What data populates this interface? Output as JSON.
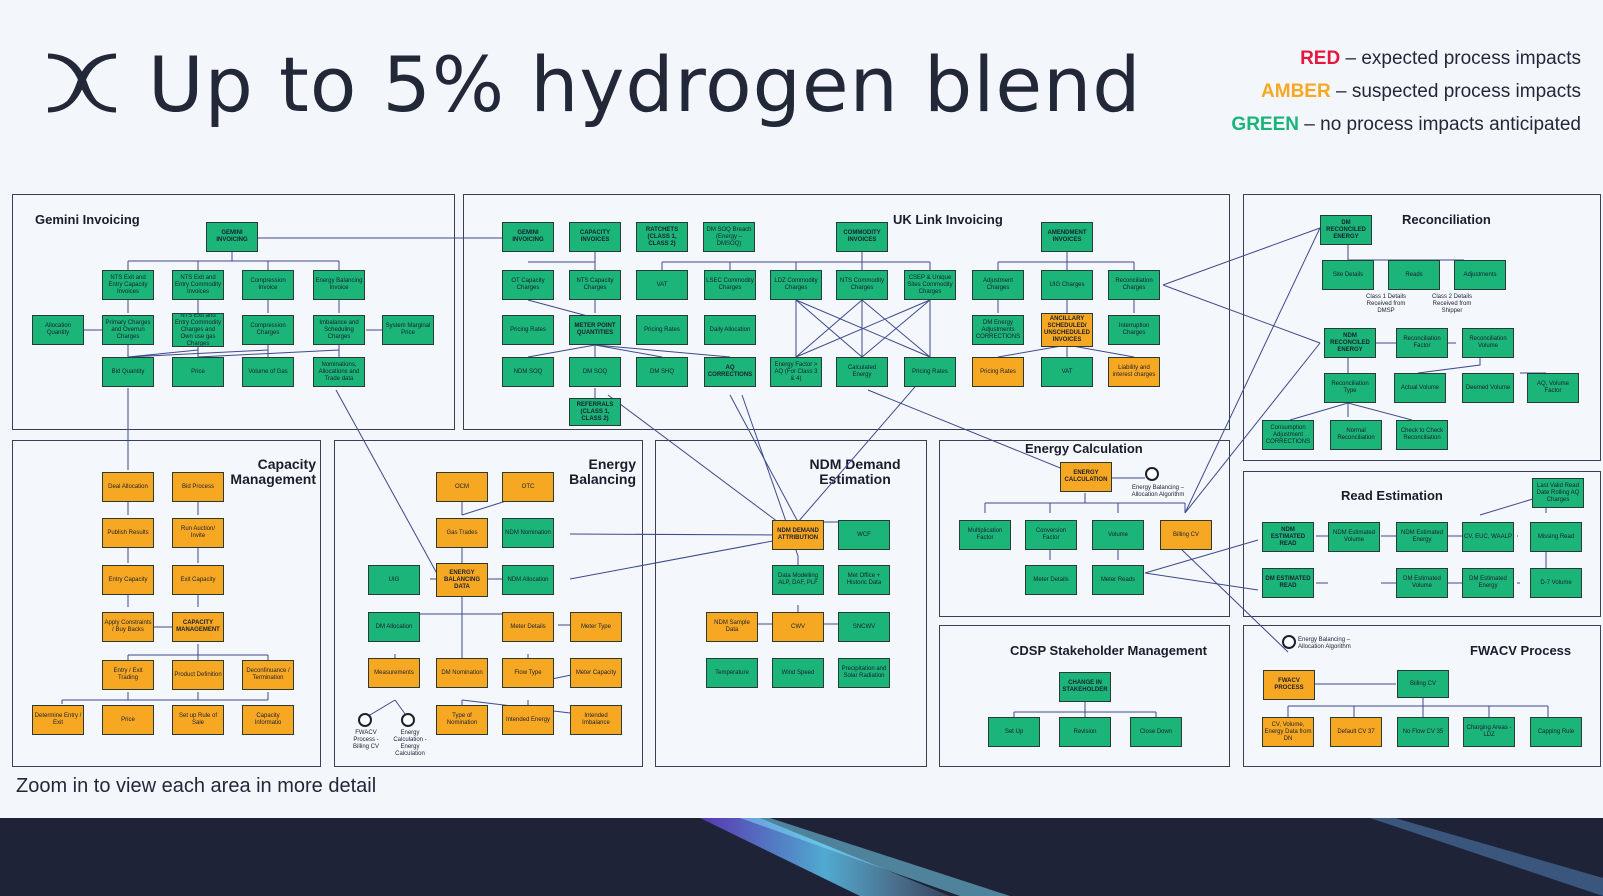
{
  "header": {
    "title": "Up to 5% hydrogen blend",
    "legend": [
      {
        "key": "RED",
        "text": " – expected process impacts",
        "color": "#e5173f"
      },
      {
        "key": "AMBER",
        "text": " – suspected process impacts",
        "color": "#f7a823"
      },
      {
        "key": "GREEN",
        "text": " – no process impacts anticipated",
        "color": "#1bb479"
      }
    ]
  },
  "colors": {
    "green": "#1bb479",
    "amber": "#f7a823",
    "line": "#3e4a8c"
  },
  "footer": {
    "zoom_text": "Zoom in to view each area in more detail"
  },
  "panels": {
    "gemini": "Gemini Invoicing",
    "uklink": "UK Link Invoicing",
    "reconciliation": "Reconciliation",
    "capacity": "Capacity\nManagement",
    "energy_balancing": "Energy\nBalancing",
    "ndm": "NDM Demand\nEstimation",
    "energy_calc": "Energy Calculation",
    "read_est": "Read Estimation",
    "cdsp": "CDSP Stakeholder Management",
    "fwacv": "FWACV Process"
  },
  "boxes": {
    "gem_inv": "GEMINI INVOICING",
    "gem_nts_exit": "NTS Exit and Entry Capacity Invoices",
    "gem_nts_comm": "NTS Exit and Entry Commodity Invoices",
    "gem_comp_inv": "Compression Invoice",
    "gem_eb_inv": "Energy Balancing Invoice",
    "gem_alloc": "Allocation Quantity",
    "gem_primary": "Primary Charges and Overrun Charges",
    "gem_nts_comm2": "NTS Exit and Entry Commodity Charges and Own use gas Charges",
    "gem_comp": "Compression Charges",
    "gem_imb": "Imbalance and Scheduling Charges",
    "gem_smp": "System Marginal Price",
    "gem_bid": "Bid Quantity",
    "gem_price": "Price",
    "gem_vol": "Volume of Gas",
    "gem_nom": "Nominations, Allocations and Trade data",
    "uk_gem": "GEMINI INVOICING",
    "uk_cap": "CAPACITY INVOICES",
    "uk_ratchets": "RATCHETS (CLASS 1, CLASS 2)",
    "uk_dmsoq": "DM SOQ Breach (Energy – DMSOQ)",
    "uk_comm": "COMMODITY INVOICES",
    "uk_amend": "AMENDMENT INVOICES",
    "uk_ot": "OT Capacity Charges",
    "uk_ntscap": "NTS Capacity Charges",
    "uk_vat": "VAT",
    "uk_lsec": "LSEC Commodity Charges",
    "uk_ldz": "LDZ Commodity Charges",
    "uk_ntscomm": "NTS Commodity Charges",
    "uk_csep": "CSEP & Unique Sites Commodity Charges",
    "uk_adj": "Adjustment Charges",
    "uk_uig": "UIG Charges",
    "uk_rec": "Reconciliation Charges",
    "uk_pricing1": "Pricing Rates",
    "uk_mpq": "METER POINT QUANTITIES",
    "uk_pricing2": "Pricing Rates",
    "uk_daily": "Daily Allocation",
    "uk_dmcorr": "DM Energy Adjustments CORRECTIONS",
    "uk_ancillary": "ANCILLARY SCHEDULED/ UNSCHEDULED INVOICES",
    "uk_interrupt": "Interruption Charges",
    "uk_ndmsoq": "NDM SOQ",
    "uk_dmsoq2": "DM SOQ",
    "uk_dmshq": "DM SHQ",
    "uk_aqcorr": "AQ CORRECTIONS",
    "uk_ef": "Energy Factor > AQ (For Class 3 & 4)",
    "uk_calc": "Calculated Energy",
    "uk_pricing3": "Pricing Rates",
    "uk_pricing4": "Pricing Rates",
    "uk_vat2": "VAT",
    "uk_liab": "Liability and interest charges",
    "uk_referrals": "REFERRALS (CLASS 1, CLASS 2)",
    "rc_dm": "DM RECONCILED ENERGY",
    "rc_site": "Site Details",
    "rc_reads": "Reads",
    "rc_adjust": "Adjustments",
    "rc_ndm": "NDM RECONCILED ENERGY",
    "rc_factor": "Reconciliation Factor",
    "rc_volume": "Reconciliation Volume",
    "rc_type": "Reconciliation Type",
    "rc_actual": "Actual Volume",
    "rc_deemed": "Deemed Volume",
    "rc_aqvol": "AQ, Volume Factor",
    "rc_cons": "Consumption Adjustment CORRECTIONS",
    "rc_normal": "Normal Reconciliation",
    "rc_check": "Check to Check Reconciliation",
    "cm_deal": "Deal Allocation",
    "cm_bid": "Bid Process",
    "cm_publish": "Publish Results",
    "cm_run": "Run Auction/ Invite",
    "cm_entry": "Entry Capacity",
    "cm_exit": "Exit Capacity",
    "cm_apply": "Apply Constraints / Buy Backs",
    "cm_cap": "CAPACITY MANAGEMENT",
    "cm_trading": "Entry / Exit Trading",
    "cm_product": "Product Definition",
    "cm_decon": "Deconfinuance / Termination",
    "cm_determine": "Determine Entry / Exit",
    "cm_price": "Price",
    "cm_rule": "Set up Rule of Sale",
    "cm_info": "Capacity Informatio",
    "eb_ocm": "OCM",
    "eb_otc": "OTC",
    "eb_gas": "Gas Trades",
    "eb_ndmnom": "NDM Nomination",
    "eb_uig": "UIG",
    "eb_data": "ENERGY BALANCING DATA",
    "eb_ndmalloc": "NDM Allocation",
    "eb_dmalloc": "DM Allocation",
    "eb_meterdet": "Meter Details",
    "eb_metertype": "Meter Type",
    "eb_measure": "Measurements",
    "eb_dmnom": "DM Nomination",
    "eb_flow": "Flow Type",
    "eb_metercap": "Meter Capacity",
    "eb_typenom": "Type of Nomination",
    "eb_intended": "Intended Energy",
    "eb_imbal": "Intended Imbalance",
    "nd_attr": "NDM DEMAND ATTRIBUTION",
    "nd_wcf": "WCF",
    "nd_model": "Data Modelling ALP, DAF, PLF",
    "nd_met": "Met Office + Historic Data",
    "nd_sample": "NDM Sample Data",
    "nd_cwv": "CWV",
    "nd_sncwv": "SNCWV",
    "nd_temp": "Temperature",
    "nd_wind": "Wind Speed",
    "nd_precip": "Precipitation and Solar Radiation",
    "ec_calc": "ENERGY CALCULATION",
    "ec_mult": "Multiplication Factor",
    "ec_conv": "Conversion Factor",
    "ec_vol": "Volume",
    "ec_billing": "Billing CV",
    "ec_meterdet": "Meter Details",
    "ec_meterreads": "Meter Reads",
    "re_lastvalid": "Last Valid Read Date Rolling AQ Charges",
    "re_ndmread": "NDM ESTIMATED READ",
    "re_ndmvol": "NDM Estimated Volume",
    "re_ndmenergy": "NDM Estimated Energy",
    "re_cv": "CV, EUC, WAALP",
    "re_missing": "Missing Read",
    "re_dmread": "DM ESTIMATED READ",
    "re_dmvol": "DM Estimated Volume",
    "re_dmenergy": "DM Estimated Energy",
    "re_d7": "D-7 Volume",
    "cd_change": "CHANGE IN STAKEHOLDER",
    "cd_setup": "Set Up",
    "cd_revision": "Revision",
    "cd_close": "Close Down",
    "fw_process": "FWACV PROCESS",
    "fw_billing": "Billing CV",
    "fw_cv": "CV, Volume, Energy Data from DN",
    "fw_default": "Default CV 37",
    "fw_noflow": "No Flow CV 35",
    "fw_charging": "Charging Areas - LDZ",
    "fw_capping": "Capping Rule"
  },
  "notes": {
    "rc_class1": "Class 1 Details Received from DMSP",
    "rc_class2": "Class 2 Details Received from Shipper",
    "ec_eb": "Energy Balancing – Allocation Algorithm",
    "fw_eb": "Energy Balancing – Allocation Algorithm",
    "eb_fwacv": "FWACV Process - Billing CV",
    "eb_energy": "Energy Calculation - Energy Calculation"
  }
}
